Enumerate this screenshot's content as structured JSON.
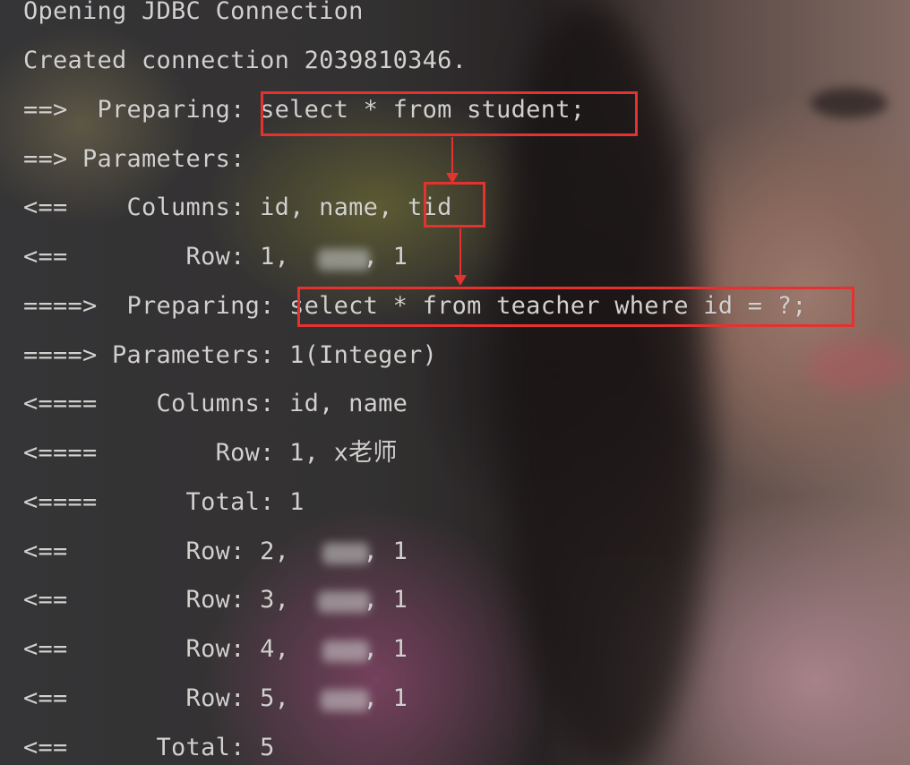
{
  "console": {
    "lines": [
      "Opening JDBC Connection",
      "Created connection 2039810346.",
      "==>  Preparing: select * from student;",
      "==> Parameters: ",
      "<==    Columns: id, name, tid",
      "<==        Row: 1,     , 1",
      "====>  Preparing: select * from teacher where id = ?;",
      "====> Parameters: 1(Integer)",
      "<====    Columns: id, name",
      "<====        Row: 1, x老师",
      "<====      Total: 1",
      "<==        Row: 2,     , 1",
      "<==        Row: 3,     , 1",
      "<==        Row: 4,     , 1",
      "<==        Row: 5,     , 1",
      "<==      Total: 5"
    ]
  },
  "highlight_color": "#e3322f",
  "text_color": "#d2d1cf"
}
